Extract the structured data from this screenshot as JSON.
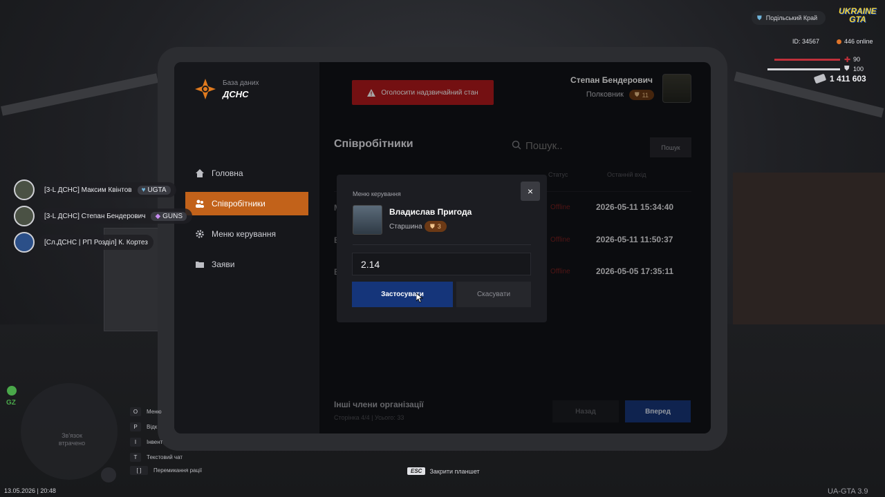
{
  "tablet": {
    "logo_sub": "База даних",
    "logo_main": "ДСНС",
    "alert_button": "Оголосити надзвичайний стан",
    "user": {
      "name": "Степан Бендерович",
      "rank": "Полковник",
      "level": "11"
    },
    "nav": [
      {
        "label": "Головна",
        "icon": "home-icon"
      },
      {
        "label": "Співробітники",
        "icon": "users-icon",
        "active": true
      },
      {
        "label": "Меню керування",
        "icon": "gear-icon"
      },
      {
        "label": "Заяви",
        "icon": "folder-icon"
      }
    ],
    "section_title": "Співробітники",
    "search": {
      "placeholder": "Пошук..",
      "button": "Пошук"
    },
    "table": {
      "headers": [
        "Статус",
        "Останній вхід"
      ],
      "rows": [
        {
          "name": "М",
          "status": "Offline",
          "last_login": "2026-05-11 15:34:40"
        },
        {
          "name": "В",
          "status": "Offline",
          "last_login": "2026-05-11 11:50:37"
        },
        {
          "name": "В",
          "status": "Offline",
          "last_login": "2026-05-05 17:35:11"
        }
      ]
    },
    "footer": {
      "title": "Інші члени організації",
      "subtitle": "Сторінка 4/4 | Усього: 33",
      "back": "Назад",
      "next": "Вперед"
    }
  },
  "modal": {
    "title": "Меню керування",
    "close": "×",
    "name": "Владислав Пригода",
    "rank": "Старшина",
    "level": "3",
    "input_value": "2.14",
    "apply": "Застосувати",
    "cancel": "Скасувати"
  },
  "hud": {
    "server": "Подільський Край",
    "logo_line1": "UKRAINE",
    "logo_line2": "GTA",
    "player_id": "ID: 34567",
    "online": "446 online",
    "health": "90",
    "armor": "100",
    "money": "1 411 603",
    "players": [
      {
        "name": "[3-L ДСНС] Максим Квінтов",
        "tag": "UGTA"
      },
      {
        "name": "[3-L ДСНС] Степан Бендерович",
        "tag": "GUNS"
      },
      {
        "name": "[Сл.ДСНС | РП Розділ] К. Кортез",
        "tag": ""
      }
    ],
    "minimap_text": "Зв'язок втрачено",
    "gz": "GZ",
    "hints": [
      {
        "key": "O",
        "label": "Меню"
      },
      {
        "key": "P",
        "label": "Відк"
      },
      {
        "key": "I",
        "label": "Інвент"
      },
      {
        "key": "T",
        "label": "Текстовий чат"
      },
      {
        "key": "[ ]",
        "label": "Перемикання рації"
      }
    ],
    "esc_key": "ESC",
    "esc_label": "Закрити планшет",
    "datetime": "13.05.2026 | 20:48",
    "version": "UA-GTA 3.9",
    "colors": {
      "accent": "#c2621a",
      "primary_blue": "#15357a",
      "danger": "#b3191d"
    }
  }
}
